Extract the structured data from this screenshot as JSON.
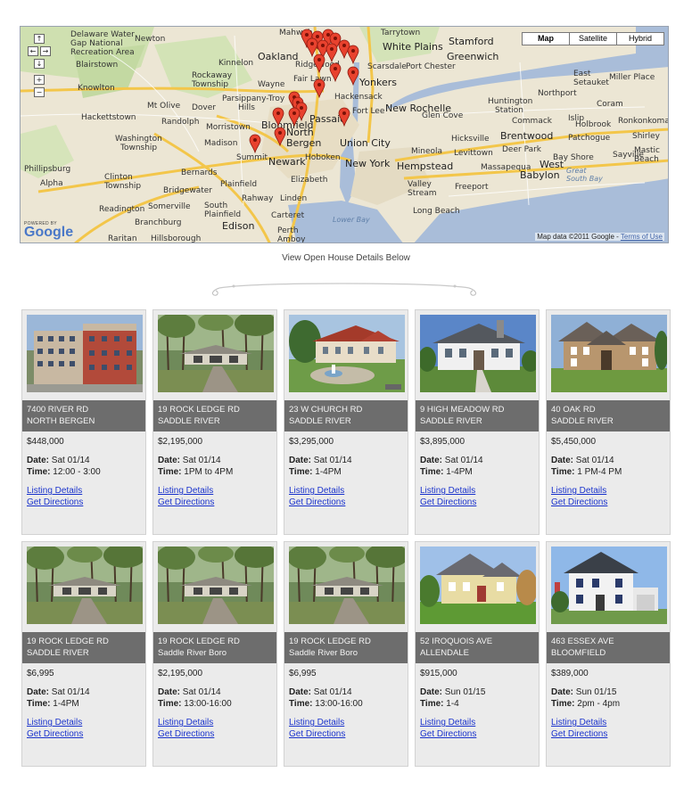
{
  "map": {
    "type_buttons": [
      "Map",
      "Satellite",
      "Hybrid"
    ],
    "active_type": "Map",
    "pan_controls": [
      "↑",
      "←",
      "→",
      "↓",
      "+",
      "−"
    ],
    "powered_by": "POWERED BY",
    "logo_word": "Google",
    "credit_text": "Map data ©2011 Google -",
    "terms_text": "Terms of Use",
    "places": [
      "Delaware Water",
      "Gap National",
      "Recreation Area",
      "Newton",
      "Blairstown",
      "Kinnelon",
      "Rockaway",
      "Township",
      "Wayne",
      "Parsippany-Troy",
      "Hills",
      "Knowlton",
      "Mt Olive",
      "Dover",
      "Randolph",
      "Hackettstown",
      "Morristown",
      "Washington",
      "Township",
      "Madison",
      "Summit",
      "Newark",
      "Phillipsburg",
      "Alpha",
      "Clinton",
      "Township",
      "Bernards",
      "Plainfield",
      "Bridgewater",
      "Rahway",
      "Linden",
      "Elizabeth",
      "Hoboken",
      "New York",
      "Readington",
      "Somerville",
      "South",
      "Plainfield",
      "Branchburg",
      "Raritan",
      "Hillsborough",
      "Edison",
      "Carteret",
      "Perth",
      "Amboy",
      "Bloomfield",
      "Passaic",
      "North",
      "Bergen",
      "Union City",
      "Fort Lee",
      "Hackensack",
      "Oakland",
      "Mahwah",
      "Tarrytown",
      "White Plains",
      "Stamford",
      "Greenwich",
      "Scarsdale",
      "Port Chester",
      "Yonkers",
      "New Rochelle",
      "Glen Cove",
      "Huntington",
      "Station",
      "Northport",
      "Commack",
      "Hicksville",
      "Levittown",
      "Brentwood",
      "Deer Park",
      "West",
      "Babylon",
      "Mineola",
      "Hempstead",
      "Massapequa",
      "Valley",
      "Stream",
      "Freeport",
      "Long Beach",
      "Bay Shore",
      "Patchogue",
      "Sayville",
      "Islip",
      "East",
      "Setauket",
      "Miller Place",
      "Coram",
      "Holbrook",
      "Ronkonkoma",
      "Shirley",
      "Mastic",
      "Beach",
      "Great",
      "South Bay",
      "Lower Bay",
      "Ridgewood",
      "Fair Lawn"
    ]
  },
  "caption": "View Open House Details Below",
  "labels": {
    "date": "Date:",
    "time": "Time:",
    "details_link": "Listing Details",
    "directions_link": "Get Directions"
  },
  "listings": [
    {
      "street": "7400 RIVER RD",
      "town": "NORTH BERGEN",
      "price": "$448,000",
      "date": "Sat 01/14",
      "time": "12:00 - 3:00",
      "photo": "apartment-building"
    },
    {
      "street": "19 ROCK LEDGE RD",
      "town": "SADDLE RIVER",
      "price": "$2,195,000",
      "date": "Sat 01/14",
      "time": "1PM to 4PM",
      "photo": "ranch-house-woods"
    },
    {
      "street": "23 W CHURCH RD",
      "town": "SADDLE RIVER",
      "price": "$3,295,000",
      "date": "Sat 01/14",
      "time": "1-4PM",
      "photo": "estate-fountain"
    },
    {
      "street": "9 HIGH MEADOW RD",
      "town": "SADDLE RIVER",
      "price": "$3,895,000",
      "date": "Sat 01/14",
      "time": "1-4PM",
      "photo": "white-mansion"
    },
    {
      "street": "40 OAK RD",
      "town": "SADDLE RIVER",
      "price": "$5,450,000",
      "date": "Sat 01/14",
      "time": "1 PM-4 PM",
      "photo": "stone-manor"
    },
    {
      "street": "19 ROCK LEDGE RD",
      "town": "SADDLE RIVER",
      "price": "$6,995",
      "date": "Sat 01/14",
      "time": "1-4PM",
      "photo": "ranch-house-woods"
    },
    {
      "street": "19 ROCK LEDGE RD",
      "town": "Saddle River Boro",
      "price": "$2,195,000",
      "date": "Sat 01/14",
      "time": "13:00-16:00",
      "photo": "ranch-house-woods"
    },
    {
      "street": "19 ROCK LEDGE RD",
      "town": "Saddle River Boro",
      "price": "$6,995",
      "date": "Sat 01/14",
      "time": "13:00-16:00",
      "photo": "ranch-house-woods"
    },
    {
      "street": "52 IROQUOIS AVE",
      "town": "ALLENDALE",
      "price": "$915,000",
      "date": "Sun 01/15",
      "time": "1-4",
      "photo": "yellow-house"
    },
    {
      "street": "463 ESSEX AVE",
      "town": "BLOOMFIELD",
      "price": "$389,000",
      "date": "Sun 01/15",
      "time": "2pm - 4pm",
      "photo": "colonial-house"
    }
  ]
}
